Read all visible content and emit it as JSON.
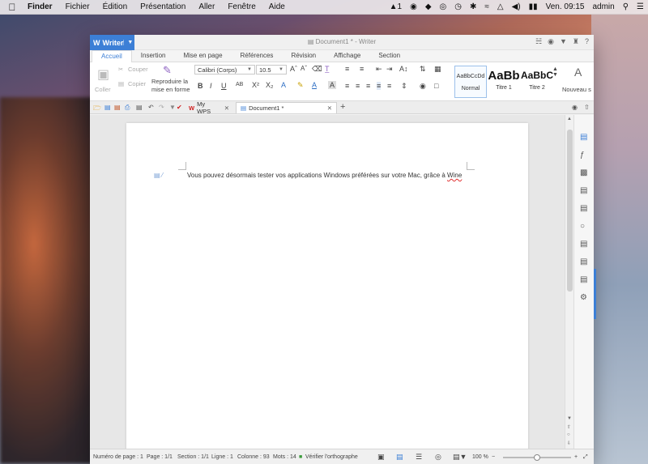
{
  "menubar": {
    "apple_icon": "apple-icon",
    "app_name": "Finder",
    "items": [
      "Fichier",
      "Édition",
      "Présentation",
      "Aller",
      "Fenêtre",
      "Aide"
    ],
    "status_adobe_count": "1",
    "clock": "Ven. 09:15",
    "user": "admin"
  },
  "window": {
    "app_button": "Writer",
    "title": "Document1 * - Writer"
  },
  "ribbon_tabs": [
    "Accueil",
    "Insertion",
    "Mise en page",
    "Références",
    "Révision",
    "Affichage",
    "Section"
  ],
  "ribbon": {
    "paste": "Coller",
    "cut": "Couper",
    "copy": "Copier",
    "format_painter_line1": "Reproduire la",
    "format_painter_line2": "mise en forme",
    "font_name": "Calibri (Corps)",
    "font_size": "10.5",
    "styles": [
      {
        "sample": "AaBbCcDd",
        "label": "Normal"
      },
      {
        "sample": "AaBb",
        "label": "Titre 1"
      },
      {
        "sample": "AaBbC",
        "label": "Titre 2"
      }
    ],
    "new_style": "Nouveau s"
  },
  "doc_tabs": {
    "tab1": "My WPS",
    "tab2": "Document1 *"
  },
  "document": {
    "text_before": "Vous pouvez désormais tester vos applications Windows préférées sur votre Mac, grâce à ",
    "text_misspelled": "Wine"
  },
  "status": {
    "page_num": "Numéro de page : 1",
    "page": "Page : 1/1",
    "section": "Section : 1/1",
    "line": "Ligne : 1",
    "column": "Colonne : 93",
    "words": "Mots : 14",
    "spellcheck": "Vérifier l'orthographe",
    "zoom": "100 %",
    "zoom_level": 0.5
  },
  "colors": {
    "accent": "#3c7fd6",
    "spell_error": "#e03030"
  }
}
